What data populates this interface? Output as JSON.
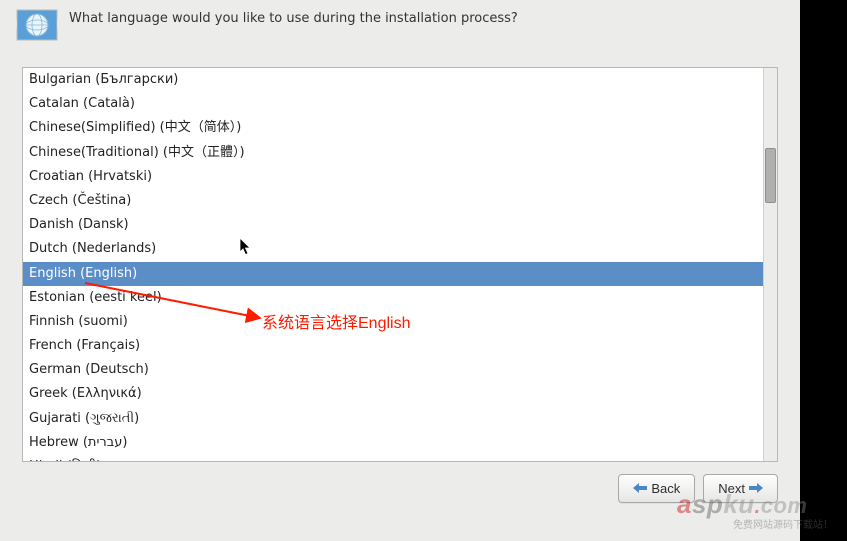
{
  "header": {
    "question": "What language would you like to use during the installation process?"
  },
  "languages": [
    {
      "label": "Bulgarian (Български)",
      "selected": false
    },
    {
      "label": "Catalan (Català)",
      "selected": false
    },
    {
      "label": "Chinese(Simplified) (中文（简体）)",
      "selected": false
    },
    {
      "label": "Chinese(Traditional) (中文（正體）)",
      "selected": false
    },
    {
      "label": "Croatian (Hrvatski)",
      "selected": false
    },
    {
      "label": "Czech (Čeština)",
      "selected": false
    },
    {
      "label": "Danish (Dansk)",
      "selected": false
    },
    {
      "label": "Dutch (Nederlands)",
      "selected": false
    },
    {
      "label": "English (English)",
      "selected": true
    },
    {
      "label": "Estonian (eesti keel)",
      "selected": false
    },
    {
      "label": "Finnish (suomi)",
      "selected": false
    },
    {
      "label": "French (Français)",
      "selected": false
    },
    {
      "label": "German (Deutsch)",
      "selected": false
    },
    {
      "label": "Greek (Ελληνικά)",
      "selected": false
    },
    {
      "label": "Gujarati (ગુજરાતી)",
      "selected": false
    },
    {
      "label": "Hebrew (עברית)",
      "selected": false
    },
    {
      "label": "Hindi (हिन्दी)",
      "selected": false
    }
  ],
  "buttons": {
    "back": "Back",
    "next": "Next"
  },
  "annotation": {
    "text": "系统语言选择English"
  },
  "watermark": {
    "line1_parts": {
      "a": "a",
      "sp": "sp",
      "ku": "ku",
      "dot": ".",
      "com": "com"
    },
    "line2": "免费网站源码下载站！"
  }
}
